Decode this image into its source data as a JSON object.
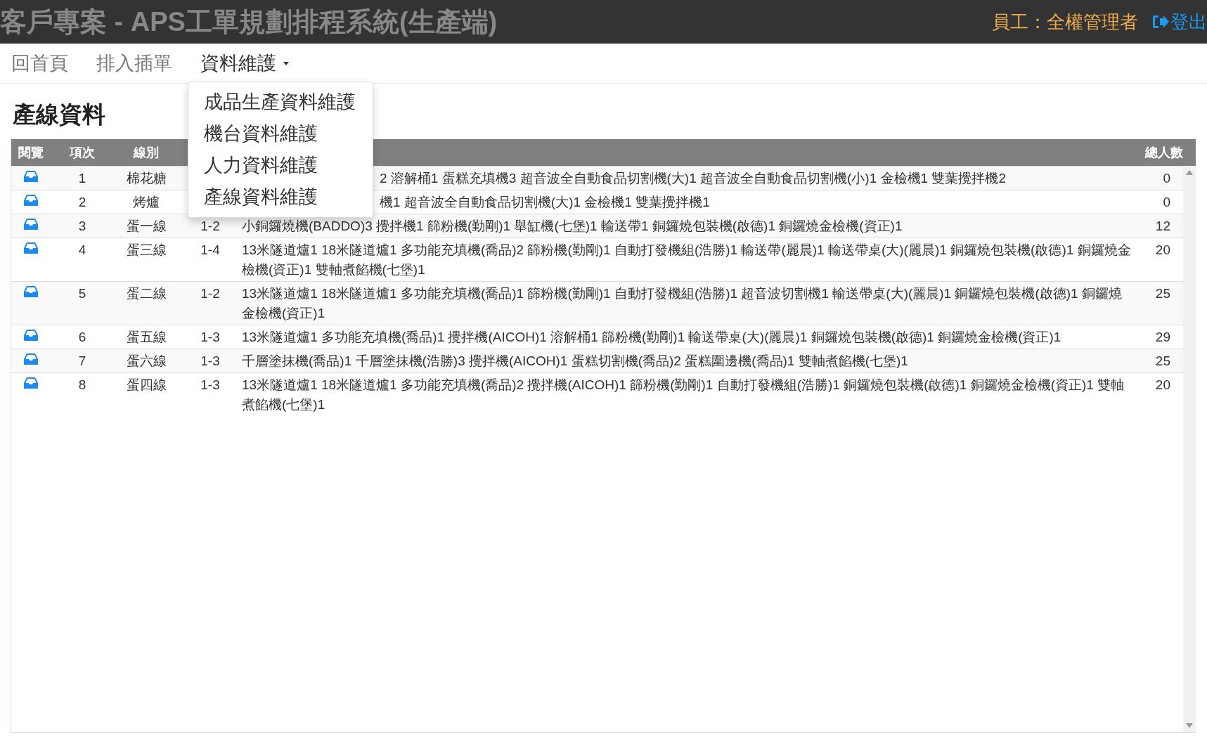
{
  "header": {
    "title": "客戶專案 - APS工單規劃排程系統(生產端)",
    "user": "員工：全權管理者",
    "logout": "登出"
  },
  "nav": [
    {
      "label": "回首頁",
      "open": false
    },
    {
      "label": "排入插單",
      "open": false
    },
    {
      "label": "資料維護",
      "open": true,
      "menu": [
        "成品生產資料維護",
        "機台資料維護",
        "人力資料維護",
        "產線資料維護"
      ]
    }
  ],
  "heading": "產線資料",
  "table": {
    "columns": [
      "閱覽",
      "項次",
      "線別",
      "總人數"
    ],
    "rows": [
      {
        "no": "1",
        "line": "棉花糖",
        "column_5": "2 溶解桶1 蛋糕充填機3 超音波全自動食品切割機(大)1 超音波全自動食品切割機(小)1 金檢機1 雙葉攪拌機2",
        "covered": true,
        "total": "0"
      },
      {
        "no": "2",
        "line": "烤爐",
        "column_5": "機1 超音波全自動食品切割機(大)1 金檢機1 雙葉攪拌機1",
        "covered": true,
        "total": "0"
      },
      {
        "no": "3",
        "line": "蛋一線",
        "column_4": "1-2",
        "column_5": "小銅鑼燒機(BADDO)3 攪拌機1 篩粉機(勤剛)1 舉缸機(七堡)1 輸送帶1 銅鑼燒包裝機(啟德)1 銅鑼燒金檢機(資正)1",
        "covered": false,
        "total": "12"
      },
      {
        "no": "4",
        "line": "蛋三線",
        "column_4": "1-4",
        "column_5": "13米隧道爐1 18米隧道爐1 多功能充填機(喬品)2 篩粉機(勤剛)1 自動打發機組(浩勝)1 輸送帶(麗晨)1 輸送帶桌(大)(麗晨)1 銅鑼燒包裝機(啟德)1 銅鑼燒金檢機(資正)1 雙軸煮餡機(七堡)1",
        "covered": false,
        "total": "20"
      },
      {
        "no": "5",
        "line": "蛋二線",
        "column_4": "1-2",
        "column_5": "13米隧道爐1 18米隧道爐1 多功能充填機(喬品)1 篩粉機(勤剛)1 自動打發機組(浩勝)1 超音波切割機1 輸送帶桌(大)(麗晨)1 銅鑼燒包裝機(啟德)1 銅鑼燒金檢機(資正)1",
        "covered": false,
        "total": "25"
      },
      {
        "no": "6",
        "line": "蛋五線",
        "column_4": "1-3",
        "column_5": "13米隧道爐1 多功能充填機(喬品)1 攪拌機(AICOH)1 溶解桶1 篩粉機(勤剛)1 輸送帶桌(大)(麗晨)1 銅鑼燒包裝機(啟德)1 銅鑼燒金檢機(資正)1",
        "covered": false,
        "total": "29"
      },
      {
        "no": "7",
        "line": "蛋六線",
        "column_4": "1-3",
        "column_5": "千層塗抹機(喬品)1 千層塗抹機(浩勝)3 攪拌機(AICOH)1 蛋糕切割機(喬品)2 蛋糕圍邊機(喬品)1 雙軸煮餡機(七堡)1",
        "covered": false,
        "total": "25"
      },
      {
        "no": "8",
        "line": "蛋四線",
        "column_4": "1-3",
        "column_5": "13米隧道爐1 18米隧道爐1 多功能充填機(喬品)2 攪拌機(AICOH)1 篩粉機(勤剛)1 自動打發機組(浩勝)1 銅鑼燒包裝機(啟德)1 銅鑼燒金檢機(資正)1 雙軸煮餡機(七堡)1",
        "covered": false,
        "total": "20"
      }
    ]
  }
}
